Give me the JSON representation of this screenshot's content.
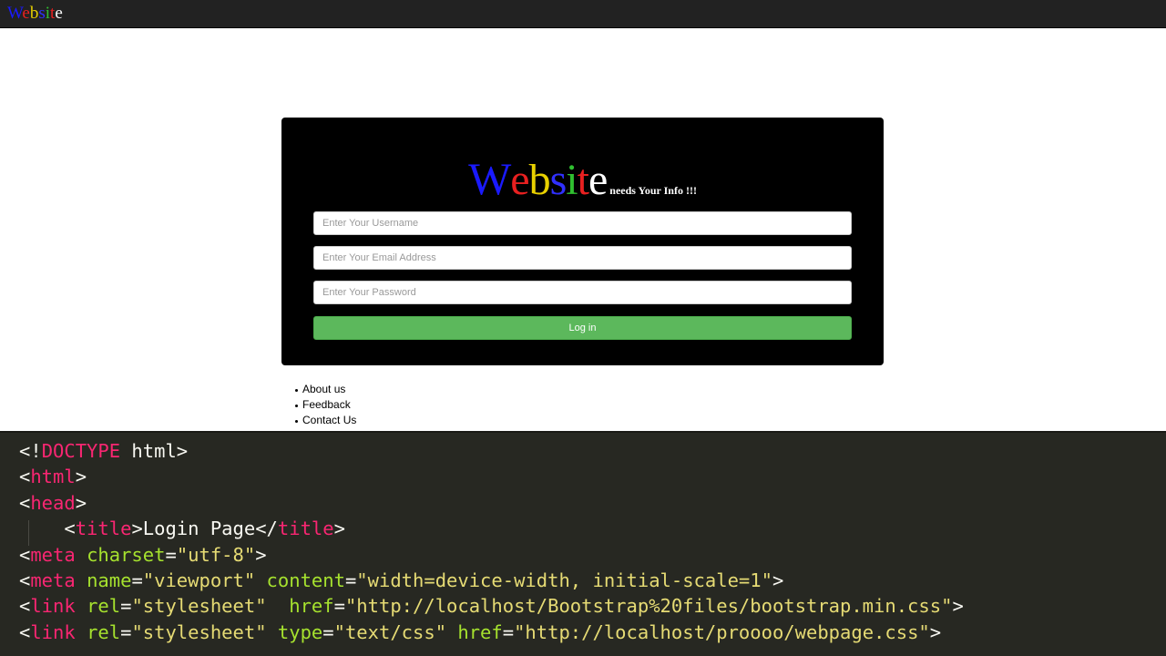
{
  "navbar": {
    "brand_letters": [
      {
        "ch": "W",
        "color": "#1a1aff"
      },
      {
        "ch": "e",
        "color": "#e82020"
      },
      {
        "ch": "b",
        "color": "#e8d000"
      },
      {
        "ch": "s",
        "color": "#3030ff"
      },
      {
        "ch": "i",
        "color": "#30c030"
      },
      {
        "ch": "t",
        "color": "#e82020"
      },
      {
        "ch": "e",
        "color": "#ffffff"
      }
    ]
  },
  "login": {
    "logo_letters": [
      {
        "ch": "W",
        "color": "#1a1aff",
        "big": true
      },
      {
        "ch": "e",
        "color": "#e82020"
      },
      {
        "ch": "b",
        "color": "#e8d000"
      },
      {
        "ch": "s",
        "color": "#3030ff"
      },
      {
        "ch": "i",
        "color": "#30c030"
      },
      {
        "ch": "t",
        "color": "#e82020"
      },
      {
        "ch": "e",
        "color": "#ffffff"
      }
    ],
    "tagline": "needs Your Info !!!",
    "username_placeholder": "Enter Your Username",
    "email_placeholder": "Enter Your Email Address",
    "password_placeholder": "Enter Your Password",
    "button_label": "Log in",
    "button_color": "#5cb85c"
  },
  "footer_links": [
    "About us",
    "Feedback",
    "Contact Us"
  ],
  "code_lines": [
    [
      [
        "tk-txt",
        "<!"
      ],
      [
        "tk-tag",
        "DOCTYPE"
      ],
      [
        "tk-txt",
        " html>"
      ]
    ],
    [
      [
        "tk-txt",
        "<"
      ],
      [
        "tk-tag",
        "html"
      ],
      [
        "tk-txt",
        ">"
      ]
    ],
    [
      [
        "tk-txt",
        "<"
      ],
      [
        "tk-tag",
        "head"
      ],
      [
        "tk-txt",
        ">"
      ]
    ],
    [
      [
        "tk-txt",
        "    <"
      ],
      [
        "tk-tag",
        "title"
      ],
      [
        "tk-txt",
        ">Login Page</"
      ],
      [
        "tk-tag",
        "title"
      ],
      [
        "tk-txt",
        ">"
      ]
    ],
    [
      [
        "tk-txt",
        "<"
      ],
      [
        "tk-tag",
        "meta"
      ],
      [
        "tk-txt",
        " "
      ],
      [
        "tk-attr",
        "charset"
      ],
      [
        "tk-txt",
        "="
      ],
      [
        "tk-str",
        "\"utf-8\""
      ],
      [
        "tk-txt",
        ">"
      ]
    ],
    [
      [
        "tk-txt",
        "<"
      ],
      [
        "tk-tag",
        "meta"
      ],
      [
        "tk-txt",
        " "
      ],
      [
        "tk-attr",
        "name"
      ],
      [
        "tk-txt",
        "="
      ],
      [
        "tk-str",
        "\"viewport\""
      ],
      [
        "tk-txt",
        " "
      ],
      [
        "tk-attr",
        "content"
      ],
      [
        "tk-txt",
        "="
      ],
      [
        "tk-str",
        "\"width=device-width, initial-scale=1\""
      ],
      [
        "tk-txt",
        ">"
      ]
    ],
    [
      [
        "tk-txt",
        "<"
      ],
      [
        "tk-tag",
        "link"
      ],
      [
        "tk-txt",
        " "
      ],
      [
        "tk-attr",
        "rel"
      ],
      [
        "tk-txt",
        "="
      ],
      [
        "tk-str",
        "\"stylesheet\""
      ],
      [
        "tk-txt",
        "  "
      ],
      [
        "tk-attr",
        "href"
      ],
      [
        "tk-txt",
        "="
      ],
      [
        "tk-str",
        "\"http://localhost/Bootstrap%20files/bootstrap.min.css\""
      ],
      [
        "tk-txt",
        ">"
      ]
    ],
    [
      [
        "tk-txt",
        "<"
      ],
      [
        "tk-tag",
        "link"
      ],
      [
        "tk-txt",
        " "
      ],
      [
        "tk-attr",
        "rel"
      ],
      [
        "tk-txt",
        "="
      ],
      [
        "tk-str",
        "\"stylesheet\""
      ],
      [
        "tk-txt",
        " "
      ],
      [
        "tk-attr",
        "type"
      ],
      [
        "tk-txt",
        "="
      ],
      [
        "tk-str",
        "\"text/css\""
      ],
      [
        "tk-txt",
        " "
      ],
      [
        "tk-attr",
        "href"
      ],
      [
        "tk-txt",
        "="
      ],
      [
        "tk-str",
        "\"http://localhost/proooo/webpage.css\""
      ],
      [
        "tk-txt",
        ">"
      ]
    ]
  ],
  "colors": {
    "navbar_bg": "#222222",
    "card_bg": "#000000",
    "code_bg": "#272822",
    "code_tag": "#f92672",
    "code_attr": "#a6e22e",
    "code_string": "#e6db74"
  }
}
